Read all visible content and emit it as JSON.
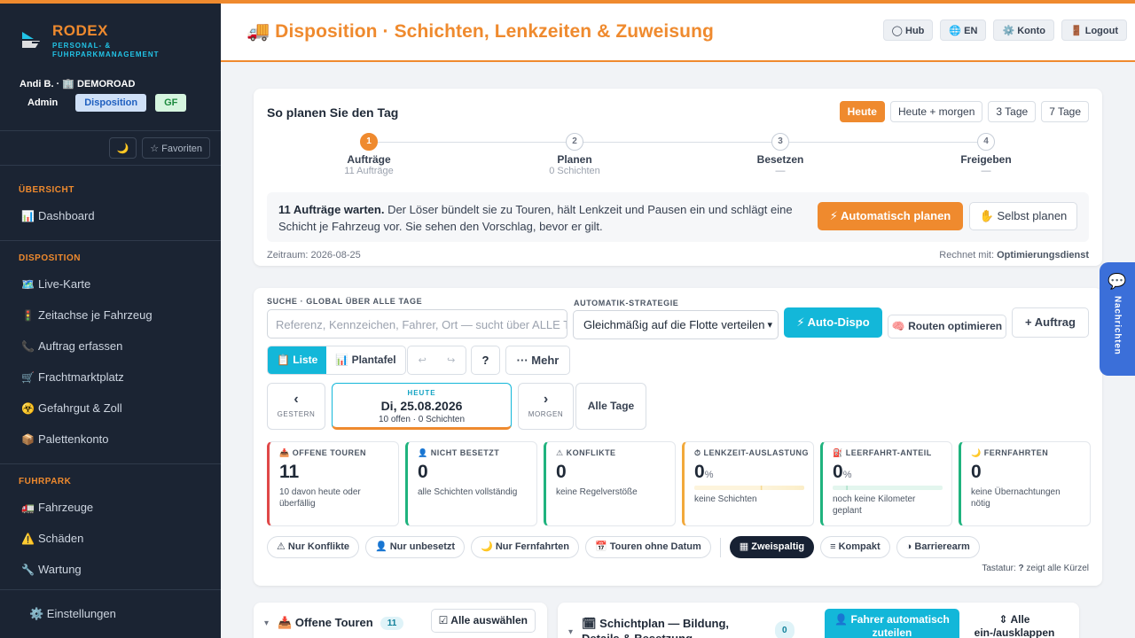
{
  "sidebar": {
    "brand_name": "RODEX",
    "brand_sub1": "PERSONAL- &",
    "brand_sub2": "FUHRPARKMANAGEMENT",
    "user": "Andi B. · 🏢 DEMOROAD",
    "roles": [
      "Admin",
      "Disposition",
      "GF"
    ],
    "theme_toggle": "🌙",
    "favorites": "☆ Favoriten",
    "sections": [
      {
        "title": "ÜBERSICHT",
        "items": [
          {
            "icon": "📊",
            "label": "Dashboard"
          }
        ]
      },
      {
        "title": "DISPOSITION",
        "items": [
          {
            "icon": "🗺️",
            "label": "Live-Karte"
          },
          {
            "icon": "🚦",
            "label": "Zeitachse je Fahrzeug"
          },
          {
            "icon": "📞",
            "label": "Auftrag erfassen"
          },
          {
            "icon": "🛒",
            "label": "Frachtmarktplatz"
          },
          {
            "icon": "☣️",
            "label": "Gefahrgut & Zoll"
          },
          {
            "icon": "📦",
            "label": "Palettenkonto"
          }
        ]
      },
      {
        "title": "FUHRPARK",
        "items": [
          {
            "icon": "🚛",
            "label": "Fahrzeuge"
          },
          {
            "icon": "⚠️",
            "label": "Schäden"
          },
          {
            "icon": "🔧",
            "label": "Wartung"
          }
        ]
      }
    ],
    "settings": "⚙️ Einstellungen"
  },
  "header": {
    "title": "🚚 Disposition · Schichten, Lenkzeiten & Zuweisung",
    "buttons": [
      "◯ Hub",
      "🌐 EN",
      "⚙️ Konto",
      "🚪 Logout"
    ]
  },
  "plan": {
    "title": "So planen Sie den Tag",
    "ranges": [
      "Heute",
      "Heute + morgen",
      "3 Tage",
      "7 Tage"
    ],
    "steps": [
      {
        "num": "1",
        "label": "Aufträge",
        "sub": "11 Aufträge"
      },
      {
        "num": "2",
        "label": "Planen",
        "sub": "0 Schichten"
      },
      {
        "num": "3",
        "label": "Besetzen",
        "sub": "—"
      },
      {
        "num": "4",
        "label": "Freigeben",
        "sub": "—"
      }
    ],
    "notice_bold": "11 Aufträge warten.",
    "notice_text": " Der Löser bündelt sie zu Touren, hält Lenkzeit und Pausen ein und schlägt eine Schicht je Fahrzeug vor. Sie sehen den Vorschlag, bevor er gilt.",
    "auto_button": "⚡ Automatisch planen",
    "self_button": "✋ Selbst planen",
    "zeitraum": "Zeitraum: 2026-08-25",
    "rechnet_label": "Rechnet mit: ",
    "rechnet_value": "Optimierungsdienst"
  },
  "controls": {
    "search_label": "SUCHE · GLOBAL ÜBER ALLE TAGE",
    "search_placeholder": "Referenz, Kennzeichen, Fahrer, Ort — sucht über ALLE Tage",
    "strategy_label": "AUTOMATIK-STRATEGIE",
    "strategy_value": "Gleichmäßig auf die Flotte verteilen",
    "auto_dispo": "⚡ Auto-Dispo",
    "routen": "🧠 Routen optimieren",
    "auftrag": "+ Auftrag",
    "view_list": "📋 Liste",
    "view_board": "📊 Plantafel",
    "undo": "↩",
    "redo": "↪",
    "help": "?",
    "mehr": "··· Mehr",
    "prev_arrow": "‹",
    "prev_label": "GESTERN",
    "today_label": "HEUTE",
    "today_date": "Di, 25.08.2026",
    "today_sub": "10 offen · 0 Schichten",
    "next_arrow": "›",
    "next_label": "MORGEN",
    "all_days": "Alle Tage"
  },
  "kpis": [
    {
      "title": "📥 OFFENE TOUREN",
      "value": "11",
      "unit": "",
      "desc": "10 davon heute oder überfällig",
      "color": "#e04848"
    },
    {
      "title": "👤 NICHT BESETZT",
      "value": "0",
      "unit": "",
      "desc": "alle Schichten vollständig",
      "color": "#1fb37e"
    },
    {
      "title": "⚠ KONFLIKTE",
      "value": "0",
      "unit": "",
      "desc": "keine Regelverstöße",
      "color": "#1fb37e"
    },
    {
      "title": "⏱ LENKZEIT-AUSLASTUNG",
      "value": "0",
      "unit": "%",
      "desc": "keine Schichten",
      "color": "#f2a93b"
    },
    {
      "title": "⛽ LEERFAHRT-ANTEIL",
      "value": "0",
      "unit": "%",
      "desc": "noch keine Kilometer geplant",
      "color": "#1fb37e"
    },
    {
      "title": "🌙 FERNFAHRTEN",
      "value": "0",
      "unit": "",
      "desc": "keine Übernachtungen nötig",
      "color": "#1fb37e"
    }
  ],
  "filters": [
    "⚠ Nur Konflikte",
    "👤 Nur unbesetzt",
    "🌙 Nur Fernfahrten",
    "📅 Touren ohne Datum",
    "▦ Zweispaltig",
    "≡ Kompakt",
    "◑ Barrierearm"
  ],
  "tastatur_pre": "Tastatur: ",
  "tastatur_key": "?",
  "tastatur_post": " zeigt alle Kürzel",
  "open_tours": {
    "title": "📥 Offene Touren",
    "count": "11",
    "select_all": "☑ Alle auswählen"
  },
  "shiftplan": {
    "title": "🗓 Schichtplan — Bildung, Details & Besetzung",
    "count": "0",
    "assign_btn": "👤 Fahrer automatisch zuteilen",
    "toggle_btn": "⇕ Alle ein-/ausklappen"
  },
  "messages": {
    "icon": "💬",
    "label": "Nachrichten"
  }
}
